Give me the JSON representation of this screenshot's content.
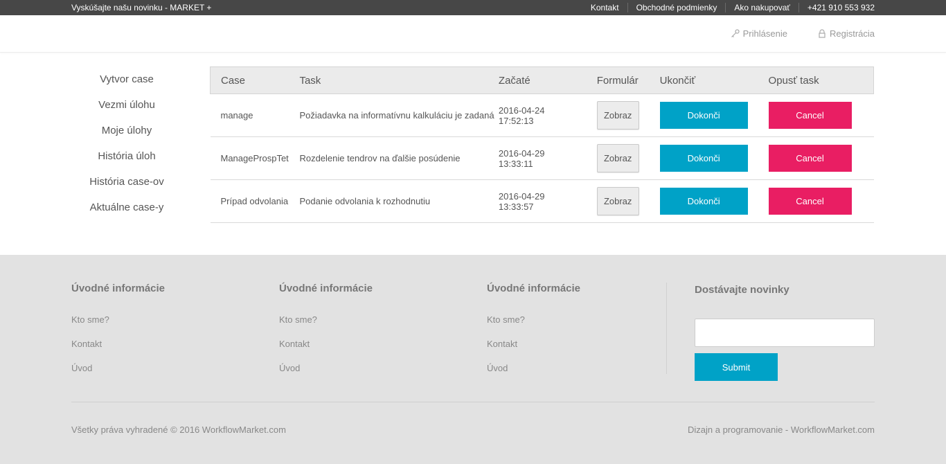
{
  "topbar": {
    "promo": "Vyskúšajte našu novinku - MARKET +",
    "links": [
      "Kontakt",
      "Obchodné podmienky",
      "Ako nakupovať",
      "+421 910 553 932"
    ]
  },
  "header": {
    "login": {
      "label": "Prihlásenie",
      "icon": "key-icon"
    },
    "register": {
      "label": "Registrácia",
      "icon": "lock-icon"
    }
  },
  "sidebar": {
    "items": [
      "Vytvor case",
      "Vezmi úlohu",
      "Moje úlohy",
      "História úloh",
      "História case-ov",
      "Aktuálne case-y"
    ]
  },
  "table": {
    "headers": [
      "Case",
      "Task",
      "Začaté",
      "Formulár",
      "Ukončiť",
      "Opusť task"
    ],
    "rows": [
      {
        "case": "manage",
        "task": "Požiadavka na informatívnu kalkuláciu je zadaná",
        "started_date": "2016-04-24",
        "started_time": "17:52:13",
        "form": "Zobraz",
        "finish": "Dokonči",
        "cancel": "Cancel"
      },
      {
        "case": "ManageProspTet",
        "task": "Rozdelenie tendrov na ďalšie posúdenie",
        "started_date": "2016-04-29",
        "started_time": "13:33:11",
        "form": "Zobraz",
        "finish": "Dokonči",
        "cancel": "Cancel"
      },
      {
        "case": "Prípad odvolania",
        "task": "Podanie odvolania k rozhodnutiu",
        "started_date": "2016-04-29",
        "started_time": "13:33:57",
        "form": "Zobraz",
        "finish": "Dokonči",
        "cancel": "Cancel"
      }
    ]
  },
  "footer": {
    "columns": [
      {
        "title": "Úvodné informácie",
        "links": [
          "Kto sme?",
          "Kontakt",
          "Úvod"
        ]
      },
      {
        "title": "Úvodné informácie",
        "links": [
          "Kto sme?",
          "Kontakt",
          "Úvod"
        ]
      },
      {
        "title": "Úvodné informácie",
        "links": [
          "Kto sme?",
          "Kontakt",
          "Úvod"
        ]
      }
    ],
    "newsletter": {
      "title": "Dostávajte novinky",
      "input_value": "",
      "submit": "Submit"
    },
    "copyright": "Všetky práva vyhradené © 2016 WorkflowMarket.com",
    "credit": "Dizajn a programovanie - WorkflowMarket.com"
  },
  "colors": {
    "accent": "#00a2c7",
    "cancel": "#e91e63",
    "topbar": "#474747",
    "footer": "#e2e2e2"
  }
}
